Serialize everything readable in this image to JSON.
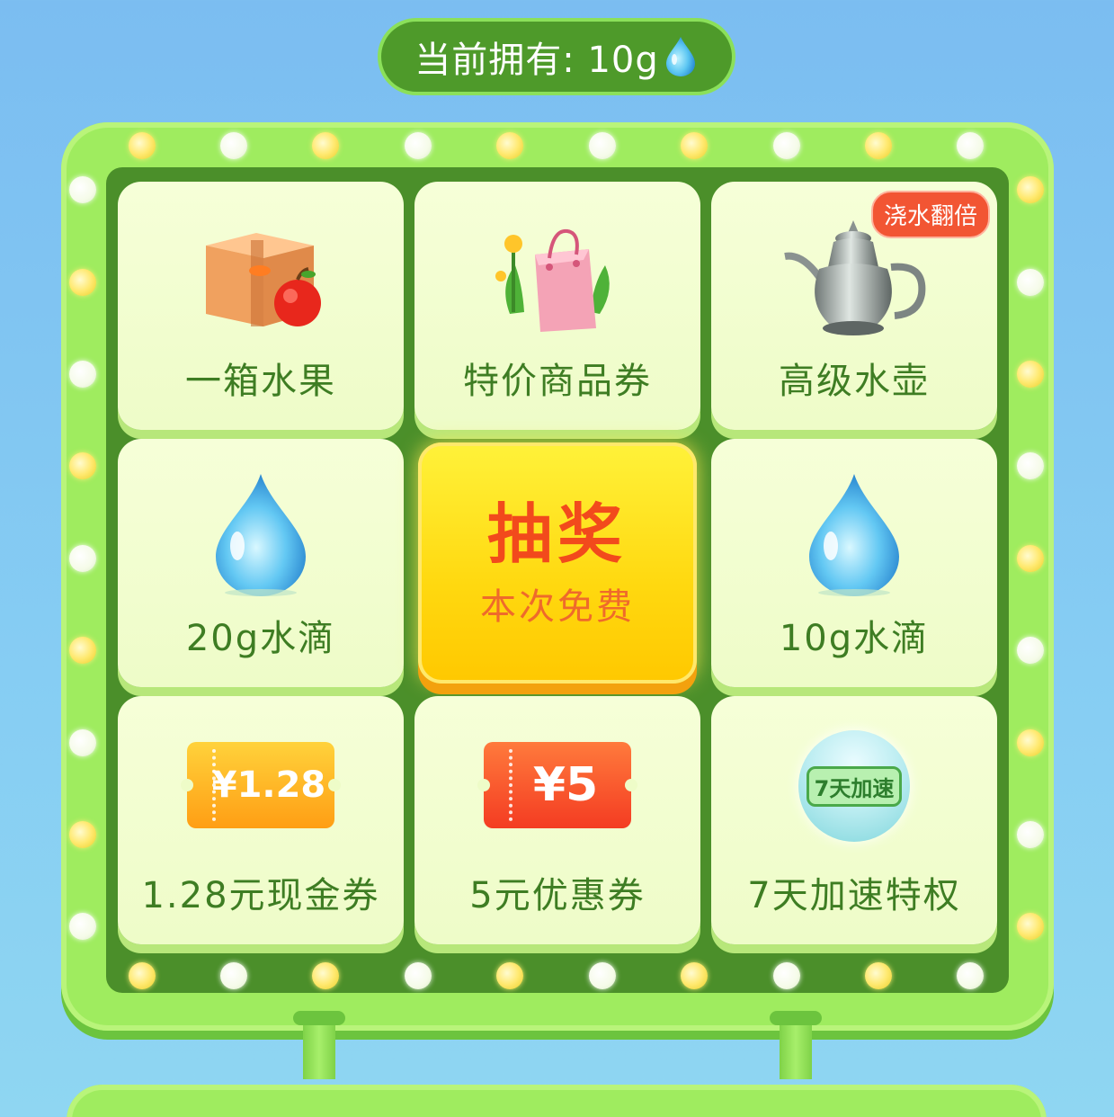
{
  "balance": {
    "text": "当前拥有: 10g",
    "icon": "water-drop-icon"
  },
  "board": {
    "colors": {
      "frame": "#9fec5f",
      "inner": "#4b8f2a",
      "tile": "#f6ffd8",
      "draw_button": "#ffd80f"
    },
    "prizes": [
      {
        "label": "一箱水果",
        "icon": "fruit-box-icon"
      },
      {
        "label": "特价商品券",
        "icon": "shopping-bag-icon"
      },
      {
        "label": "高级水壶",
        "icon": "teapot-icon",
        "badge": "浇水翻倍"
      },
      {
        "label": "20g水滴",
        "icon": "water-drop-icon"
      },
      {
        "label": "10g水滴",
        "icon": "water-drop-icon"
      },
      {
        "label": "1.28元现金券",
        "icon": "cash-coupon-icon",
        "coupon_text": "¥1.28"
      },
      {
        "label": "5元优惠券",
        "icon": "discount-coupon-icon",
        "coupon_text": "¥5"
      },
      {
        "label": "7天加速特权",
        "icon": "speed-boost-icon",
        "orb_text": "7天加速"
      }
    ],
    "draw_button": {
      "title": "抽奖",
      "subtitle": "本次免费"
    }
  }
}
